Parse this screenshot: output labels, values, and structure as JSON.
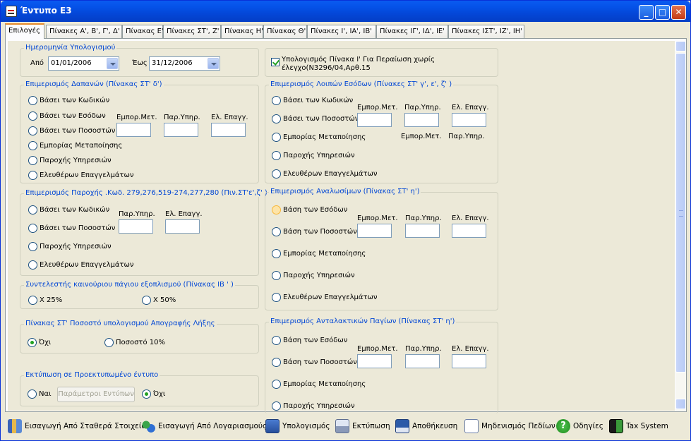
{
  "window": {
    "title": "Έντυπο Ε3"
  },
  "tabs": [
    "Επιλογές",
    "Πίνακες Α', Β', Γ', Δ'",
    "Πίνακας Ε'",
    "Πίνακες ΣΤ', Ζ'",
    "Πίνακας Η'",
    "Πίνακας Θ'",
    "Πίνακες Ι', ΙΑ', ΙΒ'",
    "Πίνακες ΙΓ', ΙΔ', ΙΕ'",
    "Πίνακες ΙΣΤ', ΙΖ', ΙΗ'"
  ],
  "date_group": {
    "title": "Ημερομηνία Υπολογισμού",
    "from_label": "Από",
    "from_value": "01/01/2006",
    "to_label": "Έως",
    "to_value": "31/12/2006"
  },
  "check_group": {
    "label": "Υπολογισμός Πίνακα Ι' Για Περαίωση χωρίς έλεγχο(Ν3296/04,Αρθ.15",
    "checked": true
  },
  "expenses": {
    "title": "Επιμερισμός Δαπανών (Πίνακας ΣΤ' δ')",
    "options": [
      "Βάσει των Κωδικών",
      "Βάσει των Εσόδων",
      "Βάσει των Ποσοστών",
      "Εμπορίας Μεταποίησης",
      "Παροχής Υπηρεσιών",
      "Ελευθέρων Επαγγελμάτων"
    ],
    "cols": [
      "Εμπορ.Μετ.",
      "Παρ.Υπηρ.",
      "Ελ. Επαγγ."
    ]
  },
  "services": {
    "title": "Επιμερισμός Παροχής .Κωδ. 279,276,519-274,277,280 (Πιν.ΣΤ'ε',ζ' )",
    "options": [
      "Βάσει των Κωδικών",
      "Βάσει των Ποσοστών",
      "Παροχής Υπηρεσιών",
      "Ελευθέρων Επαγγελμάτων"
    ],
    "cols": [
      "Παρ.Υπηρ.",
      "Ελ. Επαγγ."
    ]
  },
  "coef": {
    "title": "Συντελεστής καινούριου πάγιου εξοπλισμού (Πίνακας ΙΒ ' )",
    "options": [
      "Χ 25%",
      "Χ 50%"
    ]
  },
  "inventory": {
    "title": "Πίνακας ΣΤ' Ποσοστό υπολογισμού Απογραφής Λήξης",
    "options": [
      "Όχι",
      "Ποσοστό 10%"
    ],
    "selected": 0
  },
  "print": {
    "title": "Εκτύπωση σε Προεκτυπωμένο έντυπο",
    "yes": "Ναι",
    "params_button": "Παράμετροι Εντύπων",
    "no": "Όχι",
    "selected": "no"
  },
  "other_income": {
    "title": "Επιμερισμός Λοιπών Εσόδων (Πίνακες ΣΤ' γ', ε', ζ' )",
    "options": [
      "Βάσει των Κωδικών",
      "Βάσει των Ποσοστών",
      "Εμπορίας Μεταποίησης",
      "Παροχής Υπηρεσιών",
      "Ελευθέρων Επαγγελμάτων"
    ],
    "cols": [
      "Εμπορ.Μετ.",
      "Παρ.Υπηρ.",
      "Ελ. Επαγγ."
    ],
    "cols2": [
      "Εμπορ.Μετ.",
      "Παρ.Υπηρ."
    ]
  },
  "consumables": {
    "title": "Επιμερισμός Αναλωσίμων (Πίνακας ΣΤ' η')",
    "options": [
      "Βάση των Εσόδων",
      "Βάση των Ποσοστών",
      "Εμπορίας Μεταποίησης",
      "Παροχής Υπηρεσιών",
      "Ελευθέρων Επαγγελμάτων"
    ],
    "cols": [
      "Εμπορ.Μετ.",
      "Παρ.Υπηρ.",
      "Ελ. Επαγγ."
    ]
  },
  "spare_parts": {
    "title": "Επιμερισμός Ανταλακτικών Παγίων (Πίνακας ΣΤ' η')",
    "options": [
      "Βάση των Εσόδων",
      "Βάση των Ποσοστών",
      "Εμπορίας Μεταποίησης",
      "Παροχής Υπηρεσιών"
    ],
    "cols": [
      "Εμπορ.Μετ.",
      "Παρ.Υπηρ.",
      "Ελ. Επαγγ."
    ]
  },
  "toolbar": [
    "Εισαγωγή Από Σταθερά Στοιχεία",
    "Εισαγωγή Από Λογαριασμούς",
    "Υπολογισμός",
    "Εκτύπωση",
    "Αποθήκευση",
    "Μηδενισμός Πεδίων",
    "Οδηγίες",
    "Tax System"
  ]
}
